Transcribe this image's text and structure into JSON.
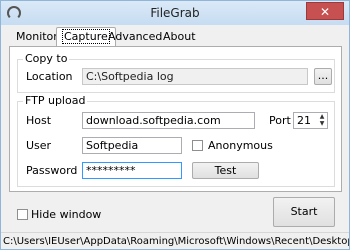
{
  "window": {
    "title": "FileGrab"
  },
  "tabs": [
    {
      "label": "Monitor"
    },
    {
      "label": "Capture"
    },
    {
      "label": "Advanced"
    },
    {
      "label": "About"
    }
  ],
  "copy_to": {
    "group_title": "Copy to",
    "location_label": "Location",
    "location_value": "C:\\Softpedia log",
    "browse_label": "..."
  },
  "ftp": {
    "group_title": "FTP upload",
    "host_label": "Host",
    "host_value": "download.softpedia.com",
    "port_label": "Port",
    "port_value": "21",
    "user_label": "User",
    "user_value": "Softpedia",
    "anonymous_label": "Anonymous",
    "password_label": "Password",
    "password_value": "*********",
    "test_label": "Test"
  },
  "bottom": {
    "hide_window_label": "Hide window",
    "start_label": "Start"
  },
  "statusbar": {
    "text": "C:\\Users\\IEUser\\AppData\\Roaming\\Microsoft\\Windows\\Recent\\Desktop (vboxsrv) (E).lnk"
  },
  "icons": {
    "app": "app-icon",
    "close": "close-icon",
    "spin": "spin-arrows-icon"
  }
}
